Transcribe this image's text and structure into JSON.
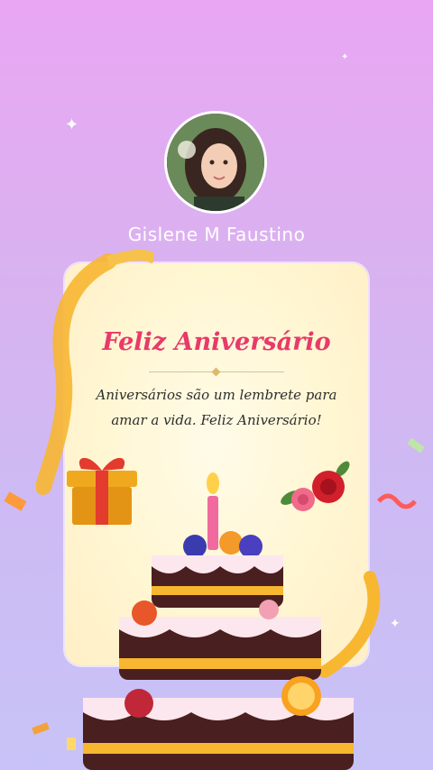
{
  "profile": {
    "name": "Gislene  M Faustino"
  },
  "card": {
    "title": "Feliz Aniversário",
    "message": "Aniversários são um lembrete para amar a vida. Feliz Aniversário!"
  },
  "colors": {
    "title": "#e83a6a",
    "background_top": "#e9a6f3",
    "background_bottom": "#c7c3f7",
    "card": "#fff6d2"
  },
  "decorations": [
    "sparkle-icon",
    "ribbon",
    "gift-icon",
    "roses-icon",
    "birthday-cake-icon"
  ]
}
